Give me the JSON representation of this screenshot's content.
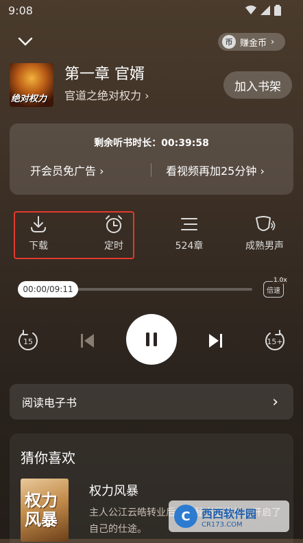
{
  "status": {
    "time": "9:08"
  },
  "header": {
    "coin_label": "赚金币",
    "coin_glyph": "币"
  },
  "book": {
    "chapter_title": "第一章 官婿",
    "book_name": "官道之绝对权力",
    "cover_text": "绝对权力",
    "shelf_button": "加入书架"
  },
  "panel": {
    "remaining_label": "剩余听书时长：00:39:58",
    "vip_label": "开会员免广告",
    "video_label": "看视频再加25分钟"
  },
  "controls": [
    {
      "label": "下载",
      "icon": "download-icon"
    },
    {
      "label": "定时",
      "icon": "alarm-clock-icon"
    },
    {
      "label": "524章",
      "icon": "list-icon"
    },
    {
      "label": "成熟男声",
      "icon": "voice-icon"
    }
  ],
  "player": {
    "time_display": "00:00/09:11",
    "progress": 0.0,
    "speed_label": "倍速",
    "speed_value": "1.0x",
    "rewind_label": "15",
    "forward_label": "15+"
  },
  "ebook": {
    "label": "阅读电子书"
  },
  "recommendations": {
    "title": "猜你喜欢",
    "items": [
      {
        "name": "权力风暴",
        "cover_text": "权力风暴",
        "description": "主人公江云皓转业后成为秘书是是长，开启了自己的仕途。"
      }
    ]
  },
  "watermark": {
    "name": "西西软件园",
    "url": "CR173.COM",
    "logo": "C"
  },
  "colors": {
    "highlight": "#e23a2e",
    "background": "#3b2f25"
  }
}
